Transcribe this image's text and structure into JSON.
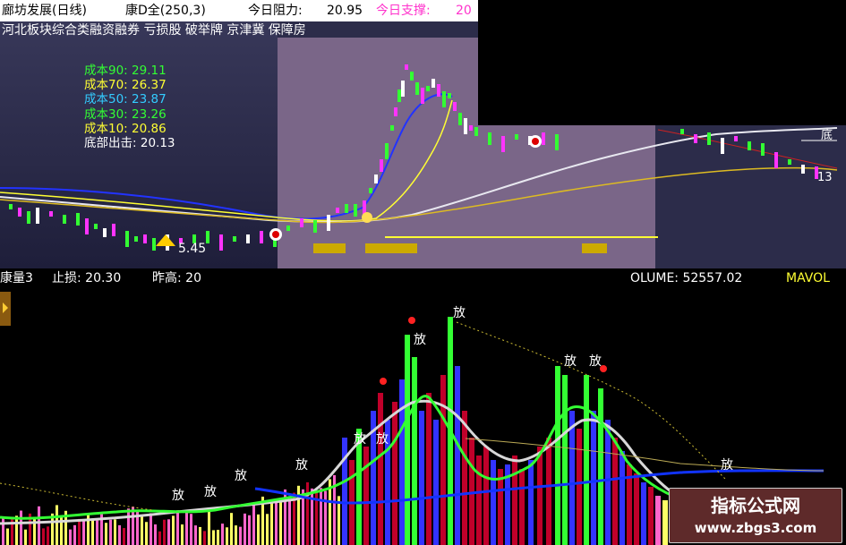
{
  "title_bar": {
    "stock_name": "廊坊发展(日线)",
    "indicator": "康D全(250,3)",
    "resistance_label": "今日阻力:",
    "resistance_value": "20.95",
    "support_label": "今日支撑:",
    "support_value": "20"
  },
  "sector_tags": "河北板块综合类融资融券 亏损股 破举牌 京津冀 保障房",
  "cost_lines": [
    {
      "label": "成本90:",
      "value": "29.11",
      "color": "#33ff33"
    },
    {
      "label": "成本70:",
      "value": "26.37",
      "color": "#ffff33"
    },
    {
      "label": "成本50:",
      "value": "23.87",
      "color": "#33ccff"
    },
    {
      "label": "成本30:",
      "value": "23.26",
      "color": "#33ff33"
    },
    {
      "label": "成本10:",
      "value": "20.86",
      "color": "#ffff33"
    },
    {
      "label": "底部出击:",
      "value": "20.13",
      "color": "#ffffff"
    }
  ],
  "upper_chart_labels": {
    "low_price": "5.45",
    "bottom_right_mark": "底",
    "right_digit": "13"
  },
  "lower_header": {
    "indicator": "康量3",
    "stop_loss": "止损: 20.30",
    "prev_high": "昨高: 20",
    "volume": "OLUME: 52557.02",
    "mavol": "MAVOL"
  },
  "volume_marker_text": "放",
  "watermark": {
    "title": "指标公式网",
    "url": "www.zbgs3.com"
  },
  "colors": {
    "up_bar": "#33ff33",
    "down_bar": "#3333ff",
    "red_bar": "#c0002a",
    "white_line": "#e8e8e8",
    "yellow_line": "#ffcc00",
    "blue_line": "#2222ff",
    "magenta": "#ff33ff"
  }
}
